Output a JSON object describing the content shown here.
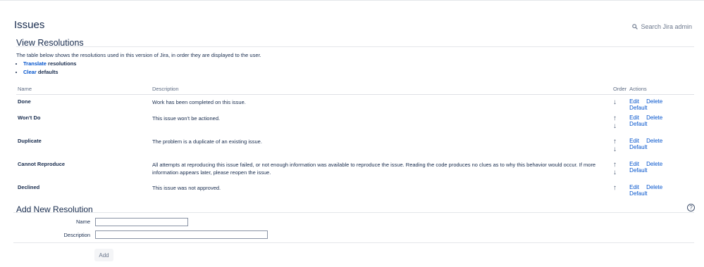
{
  "page": {
    "title": "Issues",
    "search_label": "Search Jira admin"
  },
  "view": {
    "title": "View Resolutions",
    "intro": "The table below shows the resolutions used in this version of Jira, in order they are displayed to the user.",
    "links": [
      {
        "link": "Translate",
        "suffix": " resolutions"
      },
      {
        "link": "Clear",
        "suffix": " defaults"
      }
    ]
  },
  "table": {
    "headers": {
      "name": "Name",
      "description": "Description",
      "order": "Order",
      "actions": "Actions"
    },
    "rows": [
      {
        "name": "Done",
        "description": "Work has been completed on this issue.",
        "up": "",
        "down": "↓"
      },
      {
        "name": "Won't Do",
        "description": "This issue won't be actioned.",
        "up": "↑",
        "down": "↓"
      },
      {
        "name": "Duplicate",
        "description": "The problem is a duplicate of an existing issue.",
        "up": "↑",
        "down": "↓"
      },
      {
        "name": "Cannot Reproduce",
        "description": "All attempts at reproducing this issue failed, or not enough information was available to reproduce the issue. Reading the code produces no clues as to why this behavior would occur. If more information appears later, please reopen the issue.",
        "up": "↑",
        "down": "↓"
      },
      {
        "name": "Declined",
        "description": "This issue was not approved.",
        "up": "↑",
        "down": ""
      }
    ],
    "actions": {
      "edit": "Edit",
      "delete": "Delete",
      "default": "Default"
    }
  },
  "add": {
    "title": "Add New Resolution",
    "help_icon": "?",
    "name_label": "Name",
    "description_label": "Description",
    "name_value": "",
    "description_value": "",
    "button_label": "Add"
  },
  "colors": {
    "link": "#0052cc",
    "text": "#172b4d",
    "muted": "#5e6c84"
  }
}
